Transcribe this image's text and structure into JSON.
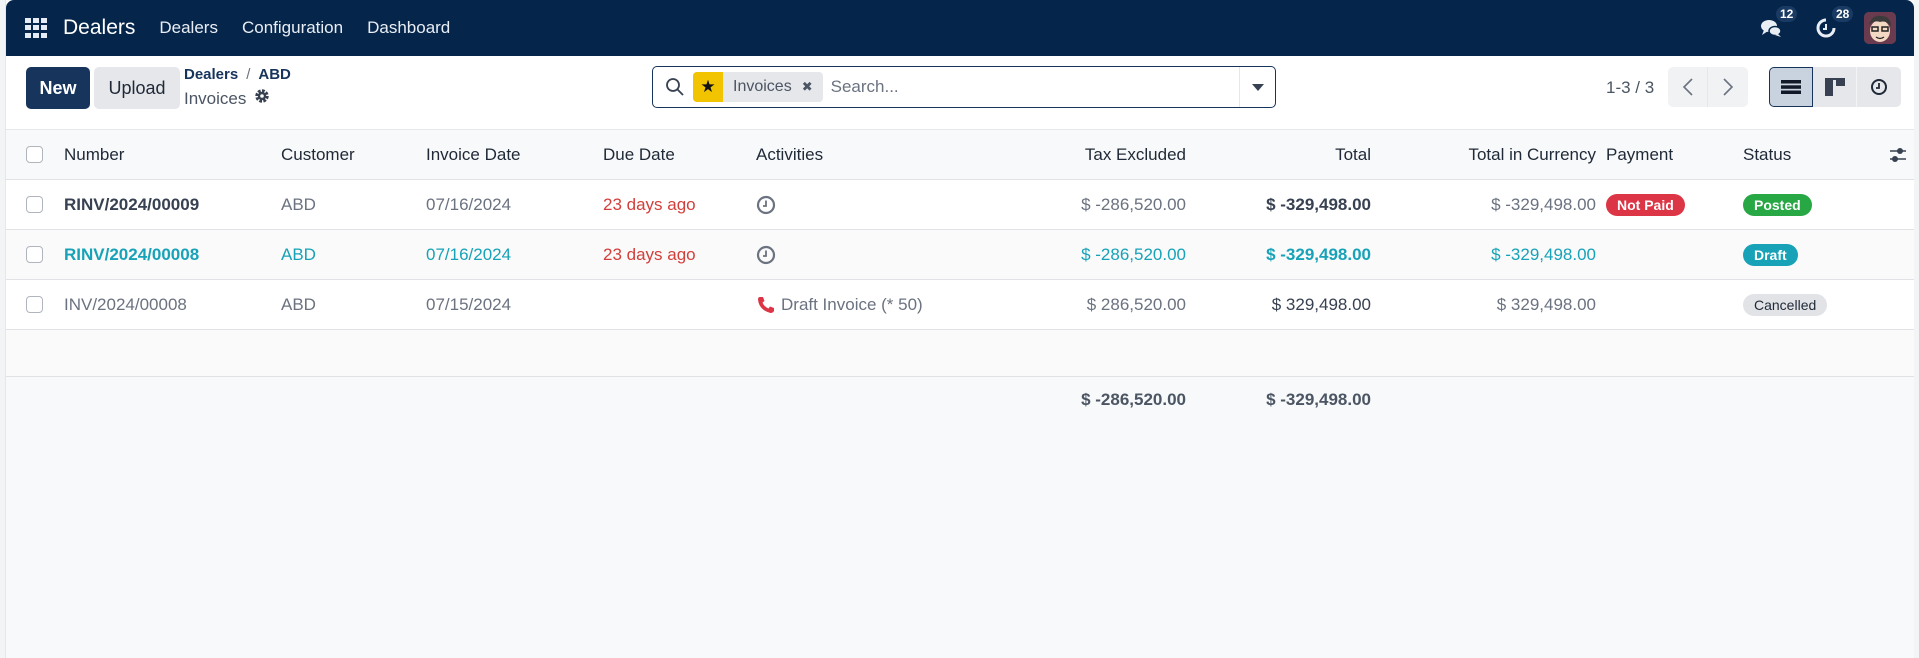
{
  "navbar": {
    "app_name": "Dealers",
    "menu": [
      "Dealers",
      "Configuration",
      "Dashboard"
    ],
    "messages_count": "12",
    "activities_count": "28"
  },
  "control": {
    "new_label": "New",
    "upload_label": "Upload",
    "breadcrumb": [
      "Dealers",
      "ABD"
    ],
    "breadcrumb_sep": "/",
    "current": "Invoices",
    "search": {
      "facet_label": "Invoices",
      "placeholder": "Search..."
    },
    "pager": "1-3 / 3"
  },
  "table": {
    "columns": [
      "Number",
      "Customer",
      "Invoice Date",
      "Due Date",
      "Activities",
      "Tax Excluded",
      "Total",
      "Total in Currency",
      "Payment",
      "Status"
    ],
    "rows": [
      {
        "number": "RINV/2024/00009",
        "customer": "ABD",
        "invoice_date": "07/16/2024",
        "due_date": "23 days ago",
        "activity": "clock",
        "activity_text": "",
        "tax_excluded": "$ -286,520.00",
        "total": "$ -329,498.00",
        "total_currency": "$ -329,498.00",
        "payment": "Not Paid",
        "status": "Posted"
      },
      {
        "number": "RINV/2024/00008",
        "customer": "ABD",
        "invoice_date": "07/16/2024",
        "due_date": "23 days ago",
        "activity": "clock",
        "activity_text": "",
        "tax_excluded": "$ -286,520.00",
        "total": "$ -329,498.00",
        "total_currency": "$ -329,498.00",
        "payment": "",
        "status": "Draft"
      },
      {
        "number": "INV/2024/00008",
        "customer": "ABD",
        "invoice_date": "07/15/2024",
        "due_date": "",
        "activity": "phone",
        "activity_text": "Draft Invoice (* 50)",
        "tax_excluded": "$ 286,520.00",
        "total": "$ 329,498.00",
        "total_currency": "$ 329,498.00",
        "payment": "",
        "status": "Cancelled"
      }
    ],
    "footer": {
      "tax_excluded": "$ -286,520.00",
      "total": "$ -329,498.00"
    }
  },
  "colors": {
    "navbar": "#06254a",
    "primary": "#17345c",
    "overdue": "#d23f3a",
    "draft_text": "#17a2b8",
    "not_paid": "#dc3545",
    "posted": "#28a745",
    "draft": "#17a2b8",
    "cancelled": "#e1e3e7",
    "facet_star": "#f2c400"
  }
}
